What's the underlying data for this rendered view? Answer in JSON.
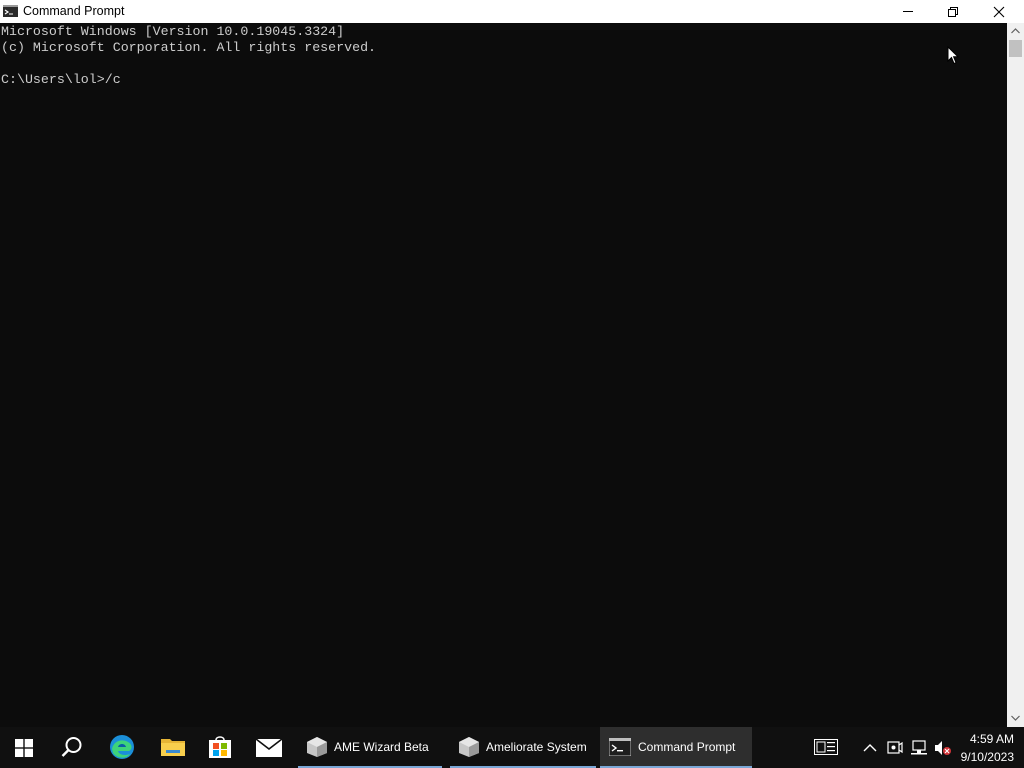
{
  "window": {
    "title": "Command Prompt",
    "icon": "cmd-icon"
  },
  "console": {
    "lines": [
      "Microsoft Windows [Version 10.0.19045.3324]",
      "(c) Microsoft Corporation. All rights reserved.",
      "",
      "C:\\Users\\lol>/c"
    ]
  },
  "taskbar": {
    "pinned": [
      {
        "name": "start-button",
        "icon": "windows-logo-icon"
      },
      {
        "name": "search-button",
        "icon": "search-icon"
      },
      {
        "name": "edge-button",
        "icon": "edge-icon"
      },
      {
        "name": "file-explorer-button",
        "icon": "folder-icon"
      },
      {
        "name": "store-button",
        "icon": "store-icon"
      },
      {
        "name": "mail-button",
        "icon": "mail-icon"
      }
    ],
    "tasks": [
      {
        "label": "AME Wizard Beta",
        "icon": "ame-wizard-icon",
        "active": false
      },
      {
        "label": "Ameliorate System",
        "icon": "ameliorate-icon",
        "active": false
      },
      {
        "label": "Command Prompt",
        "icon": "cmd-icon",
        "active": true
      }
    ],
    "tray_icons": [
      "news-widget-icon",
      "chevron-up-icon",
      "meet-now-icon",
      "network-icon",
      "volume-muted-icon"
    ],
    "clock": {
      "time": "4:59 AM",
      "date": "9/10/2023"
    }
  },
  "colors": {
    "console_bg": "#0c0c0c",
    "console_text": "#cccccc",
    "taskbar_bg": "#101010",
    "accent": "#7aa7d6"
  }
}
